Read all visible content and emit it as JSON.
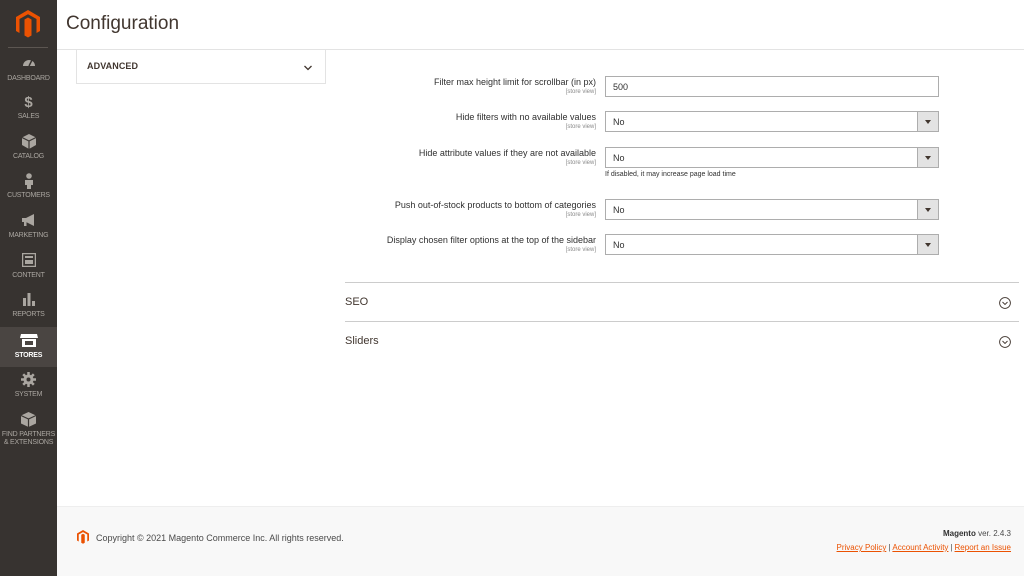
{
  "sidebar": {
    "items": [
      {
        "label": "DASHBOARD",
        "icon": "dashboard-icon"
      },
      {
        "label": "$",
        "icon": "dollar-icon"
      },
      {
        "label": "SALES",
        "icon": "sales-icon"
      },
      {
        "label": "CATALOG",
        "icon": "cube-icon"
      },
      {
        "label": "CUSTOMERS",
        "icon": "person-icon"
      },
      {
        "label": "MARKETING",
        "icon": "megaphone-icon"
      },
      {
        "label": "CONTENT",
        "icon": "layout-icon"
      },
      {
        "label": "REPORTS",
        "icon": "bar-chart-icon"
      },
      {
        "label": "STORES",
        "icon": "storefront-icon"
      },
      {
        "label": "SYSTEM",
        "icon": "gear-icon"
      },
      {
        "label": "FIND PARTNERS & EXTENSIONS",
        "icon": "box-icon"
      }
    ],
    "active": "STORES"
  },
  "header": {
    "title": "Configuration"
  },
  "config_tab": {
    "label": "ADVANCED"
  },
  "form": {
    "rows": [
      {
        "label": "Filter max height limit for scrollbar (in px)",
        "scope": "[store view]",
        "value": "500"
      },
      {
        "label": "Hide filters with no available values",
        "scope": "[store view]",
        "value": "No"
      },
      {
        "label": "Hide attribute values if they are not available",
        "scope": "[store view]",
        "value": "No",
        "note": "If disabled, it may increase page load time"
      },
      {
        "label": "Push out-of-stock products to bottom of categories",
        "scope": "[store view]",
        "value": "No"
      },
      {
        "label": "Display chosen filter options at the top of the sidebar",
        "scope": "[store view]",
        "value": "No"
      }
    ]
  },
  "sections": [
    {
      "title": "SEO"
    },
    {
      "title": "Sliders"
    }
  ],
  "footer": {
    "copyright": "Copyright © 2021 Magento Commerce Inc. All rights reserved.",
    "brand": "Magento",
    "version": "ver. 2.4.3",
    "links": [
      "Privacy Policy",
      "Account Activity",
      "Report an Issue"
    ],
    "pipe": "|"
  },
  "colors": {
    "accent": "#eb5202",
    "sidebar_bg": "#373330",
    "sidebar_text": "#aaa6a0"
  }
}
